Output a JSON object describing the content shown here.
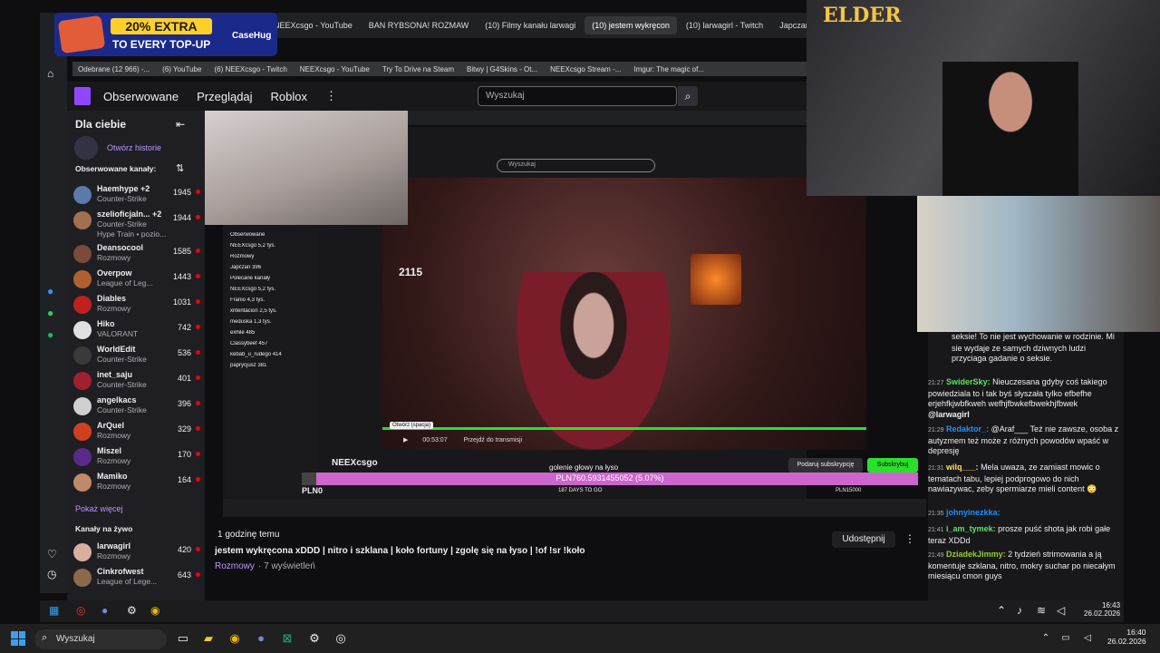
{
  "browser": {
    "tabs": [
      "NEEXcsgo - YouTube",
      "BAN RYBSONA! ROZMAW",
      "(10) Filmy kanału larwagi",
      "(10) jestem wykręcon",
      "(10) larwagirl - Twitch",
      "Japczan Stream"
    ],
    "bookmarks": [
      "Odebrane (12 966) -...",
      "(6) YouTube",
      "(6) NEEXcsgo - Twitch",
      "NEEXcsgo - YouTube",
      "Try To Drive na Steam",
      "Bitwy | G4Skins - Ot...",
      "NEEXcsgo Stream -...",
      "Imgur: The magic of..."
    ]
  },
  "promo": {
    "extra": "20% EXTRA",
    "topup": "TO EVERY TOP-UP",
    "brand": "CaseHug"
  },
  "twitch": {
    "nav": [
      "Obserwowane",
      "Przeglądaj",
      "Roblox"
    ],
    "search_placeholder": "Wyszukaj",
    "sidebar": {
      "title": "Dla ciebie",
      "history": "Otwórz historie",
      "followed_heading": "Obserwowane kanały:",
      "channels": [
        {
          "name": "Haemhype +2",
          "game": "Counter-Strike",
          "viewers": "1945",
          "color": "#5a7aa8"
        },
        {
          "name": "szelioficjaln... +2",
          "game": "Counter-Strike",
          "viewers": "1944",
          "color": "#a07050",
          "extra": "Hype Train • pozio..."
        },
        {
          "name": "Deansocool",
          "game": "Rozmowy",
          "viewers": "1585",
          "color": "#7a4a3a"
        },
        {
          "name": "Overpow",
          "game": "League of Leg...",
          "viewers": "1443",
          "color": "#b06030"
        },
        {
          "name": "Diables",
          "game": "Rozmowy",
          "viewers": "1031",
          "color": "#c02020"
        },
        {
          "name": "Hiko",
          "game": "VALORANT",
          "viewers": "742",
          "color": "#e0e0e0"
        },
        {
          "name": "WorldEdit",
          "game": "Counter-Strike",
          "viewers": "536",
          "color": "#3a3a3a"
        },
        {
          "name": "inet_saju",
          "game": "Counter-Strike",
          "viewers": "401",
          "color": "#a02030"
        },
        {
          "name": "angelkacs",
          "game": "Counter-Strike",
          "viewers": "396",
          "color": "#d0d0d0"
        },
        {
          "name": "ArQuel",
          "game": "Rozmowy",
          "viewers": "329",
          "color": "#d04020"
        },
        {
          "name": "Miszel",
          "game": "Rozmowy",
          "viewers": "170",
          "color": "#5a2a8a"
        },
        {
          "name": "Mamiko",
          "game": "Rozmowy",
          "viewers": "164",
          "color": "#c08a6a"
        }
      ],
      "show_more": "Pokaż więcej",
      "live_heading": "Kanały na żywo",
      "live": [
        {
          "name": "larwagirl",
          "game": "Rozmowy",
          "viewers": "420",
          "color": "#d8b0a0"
        },
        {
          "name": "Cinkrofwest",
          "game": "League of Lege...",
          "viewers": "643",
          "color": "#8a6a4a"
        }
      ]
    },
    "video": {
      "score": "2115",
      "tooltip": "Otwórz (spacja)",
      "time": "00:53:07",
      "jump": "Przejdź do transmisji",
      "overlay_text": "golenie głowy na łyso",
      "streamer": "NEEXcsgo",
      "progress_text": "PLN760.5931455052 (5.07%)",
      "progress_left": "PLN0",
      "progress_mid": "187 DAYS TO GO",
      "progress_right": "PLN15000",
      "gift_sub": "Podaruj subskrypcję",
      "subscribe": "Subskrybuj",
      "inner_search": "Wyszukaj",
      "inner_side": [
        "Obserwowane",
        "NEEXcsgo 5,2 tys.",
        "Rozmowy",
        "Japczan 396",
        "Polecane kanały",
        "NEEXcsgo 5,2 tys.",
        "Franio 4,3 tys.",
        "xntentacion 2,5 tys.",
        "meduska 1,3 tys.",
        "exhile 485",
        "Classybeef 457",
        "kebab_u_rudego 414",
        "paprycjusz 381"
      ]
    },
    "info": {
      "when": "1 godzinę temu",
      "title": "jestem wykręcona xDDD | nitro i szklana | koło fortuny | zgolę się na łyso | !of !sr !koło",
      "category": "Rozmowy",
      "views": "· 7 wyświetleń",
      "share": "Udostępnij"
    }
  },
  "overlay": {
    "elder": "ELDER"
  },
  "chat": [
    {
      "time": "",
      "user": "",
      "text": "seksie! To nie jest wychowanie w rodzinie. Mi sie wydaje ze samych dziwnych ludzi przyciaga gadanie o seksie.",
      "uclass": "u1"
    },
    {
      "time": "21:27",
      "user": "SwiderSky:",
      "text": " Nieuczesana gdyby coś takiego powiedziala to i tak byś słyszała tylko efbefhe erjehfkjwbfkweh wefhjfbwkefbwekhjfbwek ",
      "mention": "@larwagirl",
      "uclass": "u4"
    },
    {
      "time": "21:29",
      "user": "Redaktor_:",
      "text": " @Araf___ Też nie zawsze, osoba z autyzmem też może z różnych powodów wpaść w depresję",
      "uclass": "u2"
    },
    {
      "time": "21:31",
      "user": "wilq___:",
      "text": " Mela uwaza, ze zamiast mowic o tematach tabu, lepiej podprogowo do nich nawiazywac, zeby spermiarze mieli content 😳",
      "uclass": "u3"
    },
    {
      "time": "21:35",
      "user": "johnyinezkka:",
      "text": "",
      "uclass": "u2"
    },
    {
      "time": "21:41",
      "user": "i_am_tymek:",
      "text": " prosze puść shota jak robi gałe teraz XDDd",
      "uclass": "u4"
    },
    {
      "time": "21:49",
      "user": "DziadekJimmy:",
      "text": " 2 tydzień strimowania a ją komentuje szklana, nitro, mokry suchar po niecałym miesiącu cmon guys",
      "uclass": "u5"
    }
  ],
  "taskbar": {
    "inner_time": "16:43",
    "inner_date": "26.02.2026",
    "search": "Wyszukaj",
    "time": "16:40",
    "date": "26.02.2026"
  }
}
